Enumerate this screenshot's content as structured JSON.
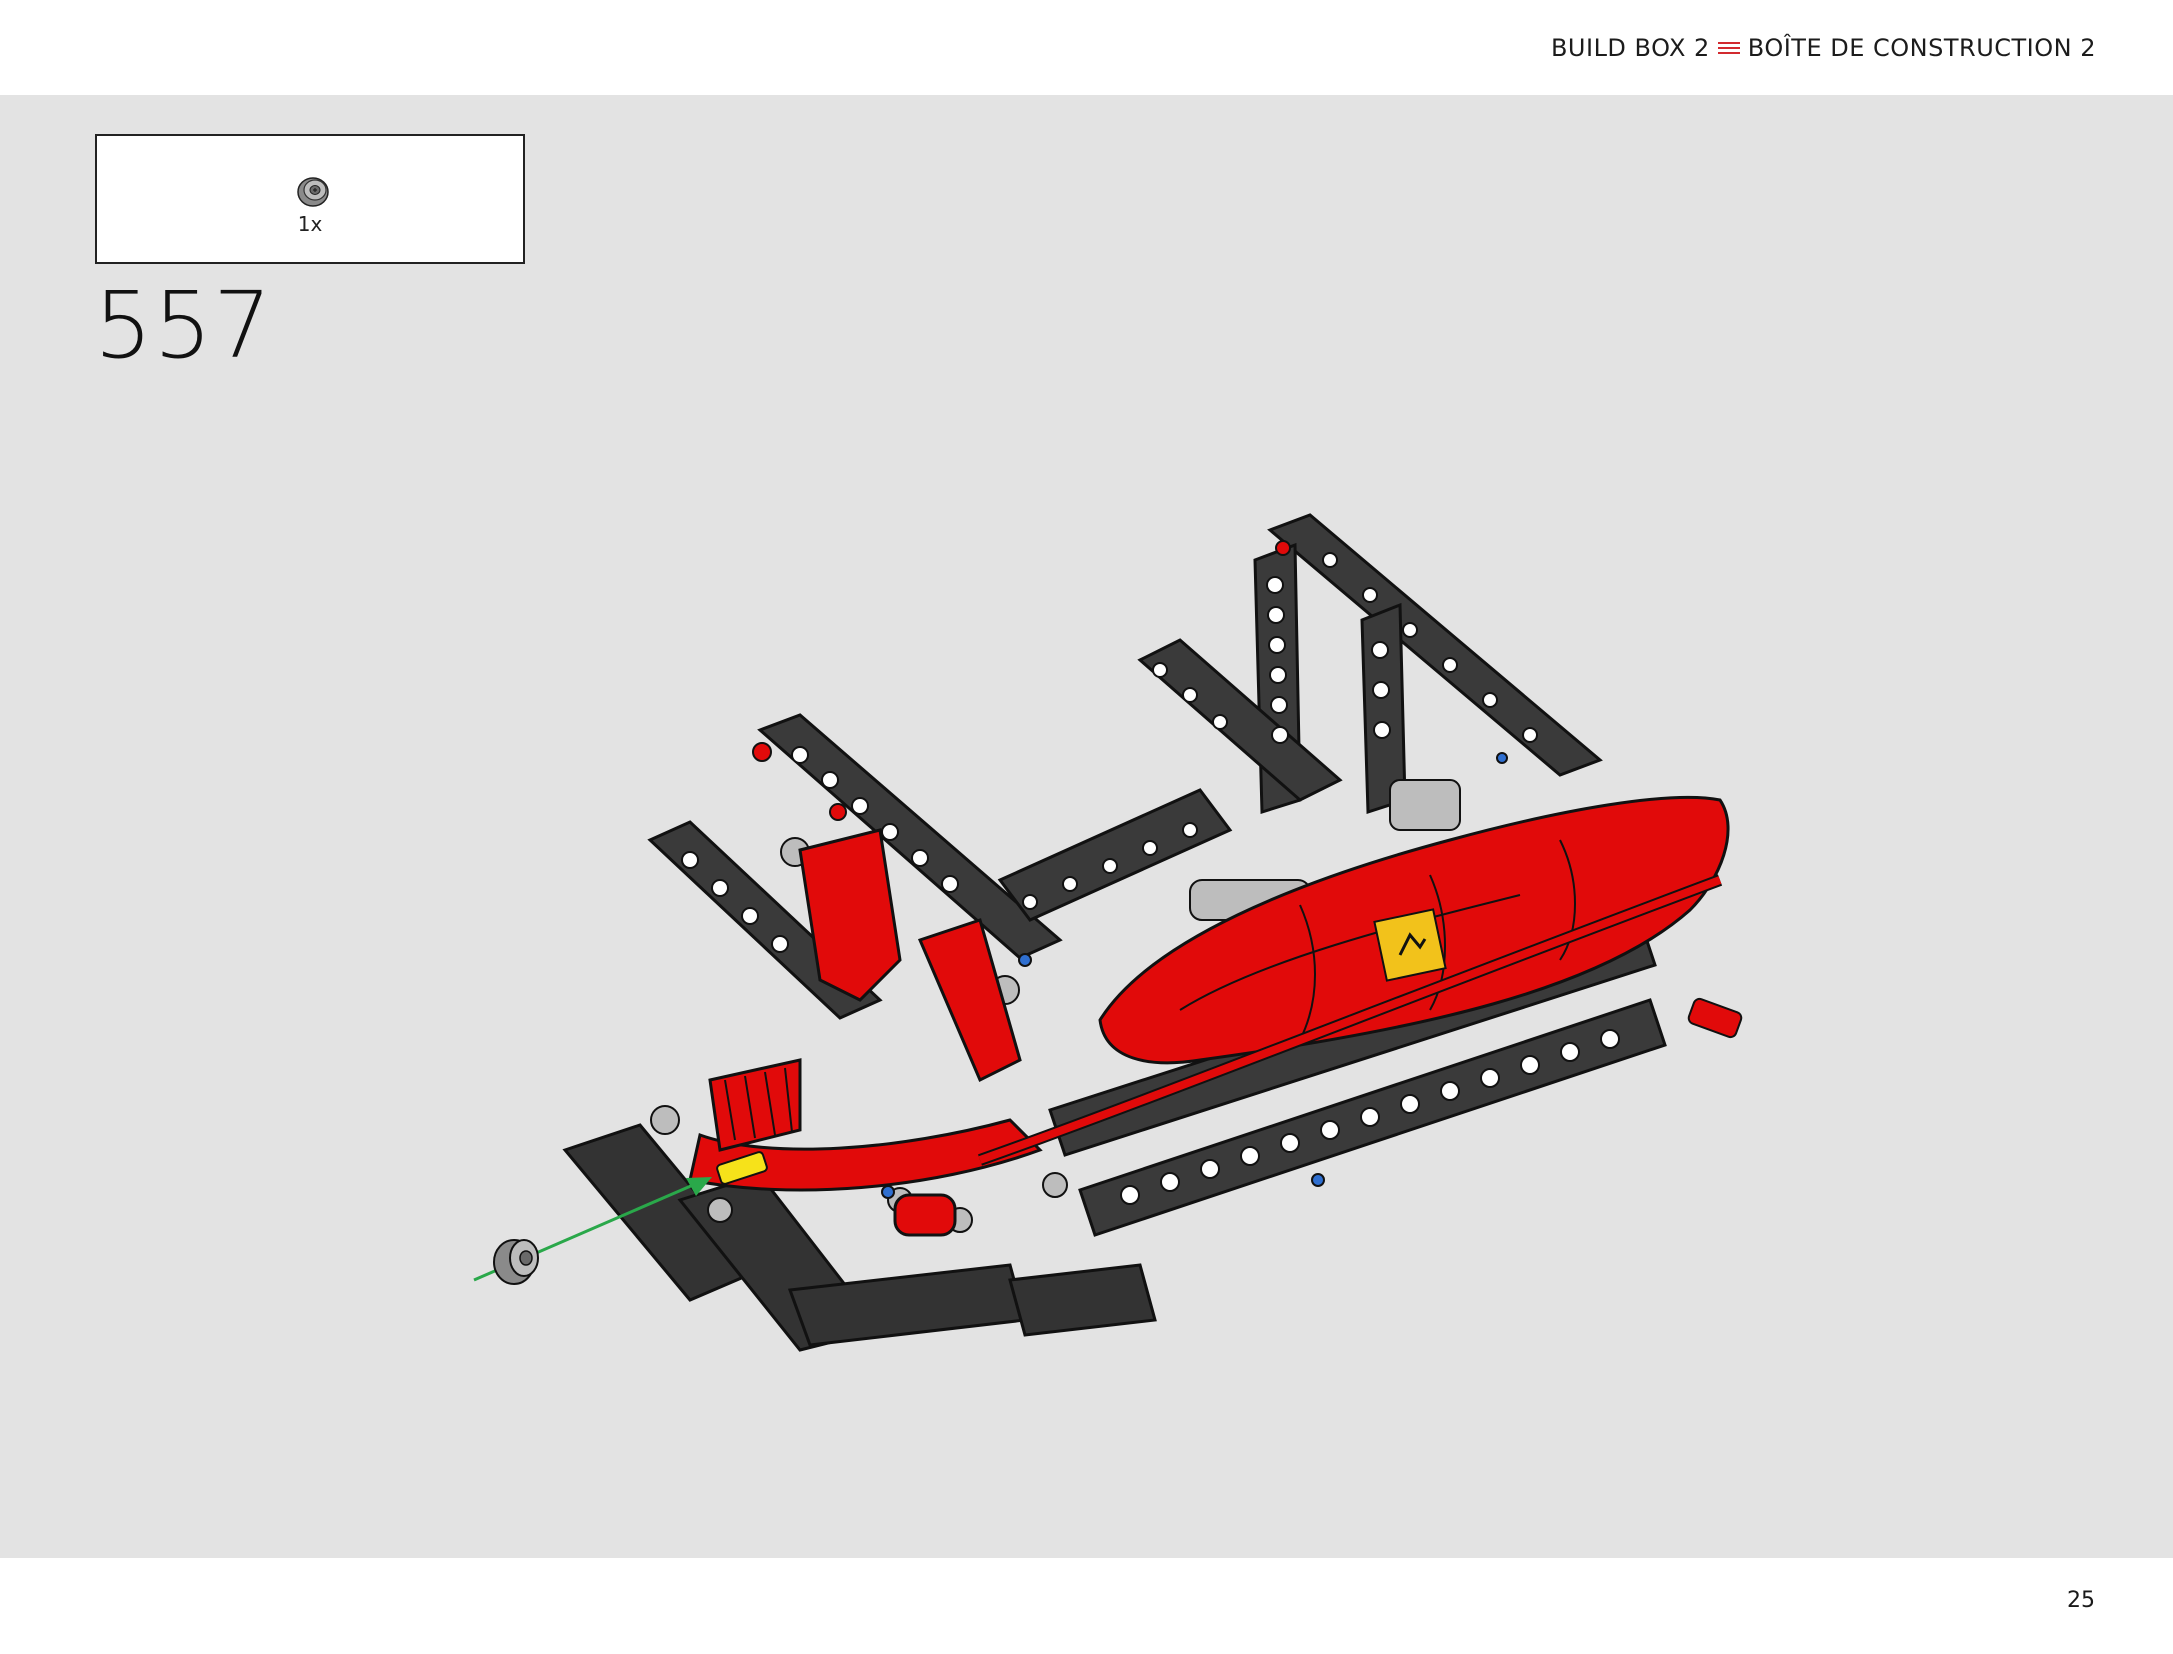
{
  "header": {
    "box_en": "BUILD BOX 2",
    "box_fr": "BOÎTE DE CONSTRUCTION 2"
  },
  "parts": {
    "quantity": "1x",
    "icon": "bush-icon"
  },
  "step": {
    "number": "557"
  },
  "footer": {
    "page_number": "25"
  },
  "colors": {
    "accent_red": "#d22a2f",
    "model_red": "#e10a0a",
    "beam_dark": "#3a3a3a",
    "arrow_green": "#2aa84a",
    "background": "#e3e3e3"
  }
}
